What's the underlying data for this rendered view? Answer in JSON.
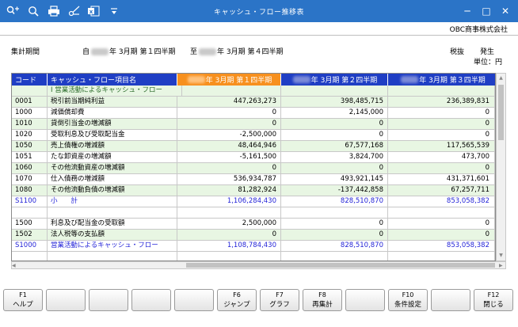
{
  "window": {
    "title": "キャッシュ・フロー推移表",
    "minimize": "─",
    "maximize": "□",
    "close": "✕"
  },
  "toolbar": {
    "icons": [
      "search-user-icon",
      "zoom-icon",
      "print-icon",
      "cut-icon",
      "excel-icon",
      "menu-dropdown-icon"
    ],
    "excel_label": "x"
  },
  "company": "OBC商事株式会社",
  "period": {
    "label": "集計期間",
    "from_prefix": "自",
    "from_year": "年",
    "from_term": "3月期 第１四半期",
    "to_prefix": "至",
    "to_year": "年",
    "to_term": "3月期 第４四半期"
  },
  "tax": {
    "method": "税抜",
    "basis": "発生",
    "unit": "単位：円"
  },
  "table": {
    "headers": {
      "code": "コード",
      "name": "キャッシュ・フロー項目名",
      "col1": "年 3月期 第１四半期",
      "col2": "年 3月期 第２四半期",
      "col3": "年 3月期 第３四半期"
    },
    "rows": [
      {
        "code": "",
        "name": "Ⅰ 営業活動によるキャッシュ・フロー",
        "v1": "",
        "v2": "",
        "v3": "",
        "type": "section"
      },
      {
        "code": "0001",
        "name": "税引前当期純利益",
        "v1": "447,263,273",
        "v2": "398,485,715",
        "v3": "236,389,831",
        "type": "data"
      },
      {
        "code": "1000",
        "name": "減価償却費",
        "v1": "0",
        "v2": "2,145,000",
        "v3": "0",
        "type": "data"
      },
      {
        "code": "1010",
        "name": "貸倒引当金の増減額",
        "v1": "0",
        "v2": "0",
        "v3": "0",
        "type": "data"
      },
      {
        "code": "1020",
        "name": "受取利息及び受取配当金",
        "v1": "-2,500,000",
        "v2": "0",
        "v3": "0",
        "type": "data"
      },
      {
        "code": "1050",
        "name": "売上債権の増減額",
        "v1": "48,464,946",
        "v2": "67,577,168",
        "v3": "117,565,539",
        "type": "data"
      },
      {
        "code": "1051",
        "name": "たな卸資産の増減額",
        "v1": "-5,161,500",
        "v2": "3,824,700",
        "v3": "473,700",
        "type": "data"
      },
      {
        "code": "1060",
        "name": "その他流動資産の増減額",
        "v1": "0",
        "v2": "0",
        "v3": "0",
        "type": "data"
      },
      {
        "code": "1070",
        "name": "仕入債務の増減額",
        "v1": "536,934,787",
        "v2": "493,921,145",
        "v3": "431,371,601",
        "type": "data"
      },
      {
        "code": "1080",
        "name": "その他流動負債の増減額",
        "v1": "81,282,924",
        "v2": "-137,442,858",
        "v3": "67,257,711",
        "type": "data"
      },
      {
        "code": "S1100",
        "name": "小　　計",
        "v1": "1,106,284,430",
        "v2": "828,510,870",
        "v3": "853,058,382",
        "type": "sum"
      },
      {
        "code": "",
        "name": "",
        "v1": "",
        "v2": "",
        "v3": "",
        "type": "blank"
      },
      {
        "code": "1500",
        "name": "利息及び配当金の受取額",
        "v1": "2,500,000",
        "v2": "0",
        "v3": "0",
        "type": "data"
      },
      {
        "code": "1502",
        "name": "法人税等の支払額",
        "v1": "0",
        "v2": "0",
        "v3": "0",
        "type": "data"
      },
      {
        "code": "S1000",
        "name": "営業活動によるキャッシュ・フロー",
        "v1": "1,108,784,430",
        "v2": "828,510,870",
        "v3": "853,058,382",
        "type": "sum"
      },
      {
        "code": "",
        "name": "",
        "v1": "",
        "v2": "",
        "v3": "",
        "type": "blank"
      }
    ]
  },
  "fkeys": [
    {
      "key": "F1",
      "label": "ヘルプ"
    },
    {
      "key": "",
      "label": ""
    },
    {
      "key": "",
      "label": ""
    },
    {
      "key": "",
      "label": ""
    },
    {
      "key": "",
      "label": ""
    },
    {
      "key": "F6",
      "label": "ジャンプ"
    },
    {
      "key": "F7",
      "label": "グラフ"
    },
    {
      "key": "F8",
      "label": "再集計"
    },
    {
      "key": "",
      "label": ""
    },
    {
      "key": "F10",
      "label": "条件設定"
    },
    {
      "key": "",
      "label": ""
    },
    {
      "key": "F12",
      "label": "閉じる"
    }
  ],
  "colors": {
    "titlebar": "#2b74c7",
    "header_blue": "#1f3ec4",
    "header_orange": "#f7901e",
    "row_green": "#e8f6e3",
    "sum_text": "#2424d8"
  }
}
